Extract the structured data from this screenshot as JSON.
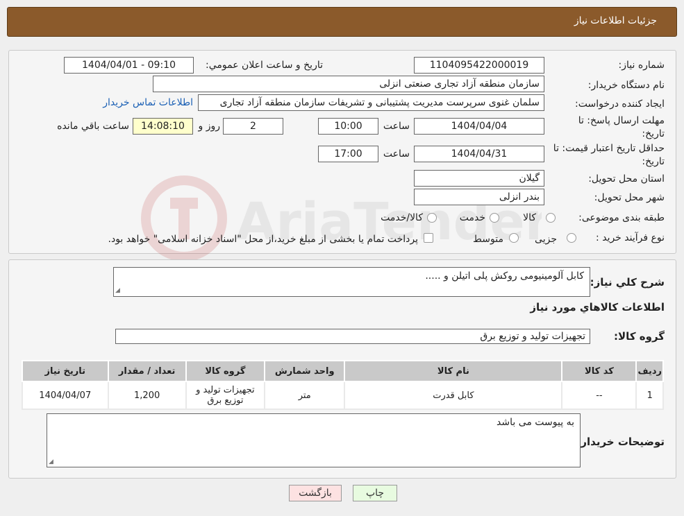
{
  "header": {
    "title": "جزئیات اطلاعات نیاز"
  },
  "form": {
    "need_number_label": "شماره نیاز:",
    "need_number": "1104095422000019",
    "announce_label": "تاریخ و ساعت اعلان عمومي:",
    "announce_value": "1404/04/01 - 09:10",
    "buyer_org_label": "نام دستگاه خریدار:",
    "buyer_org": "سازمان منطقه آزاد تجاری  صنعتی انزلی",
    "creator_label": "ایجاد کننده درخواست:",
    "creator": "سلمان غنوی سرپرست مدیریت پشتیبانی و تشریفات سازمان منطقه آزاد تجاری",
    "contact_link": "اطلاعات تماس خریدار",
    "deadline_label": "مهلت ارسال پاسخ: تا تاریخ:",
    "deadline_date": "1404/04/04",
    "time_label": "ساعت",
    "deadline_time": "10:00",
    "days_value": "2",
    "days_label": "روز و",
    "remaining_time": "14:08:10",
    "remaining_label": "ساعت باقي مانده",
    "validity_label": "حداقل تاریخ اعتبار قیمت: تا تاریخ:",
    "validity_date": "1404/04/31",
    "validity_time": "17:00",
    "province_label": "استان محل تحویل:",
    "province": "گیلان",
    "city_label": "شهر محل تحویل:",
    "city": "بندر انزلی",
    "category_label": "طبقه بندی موضوعی:",
    "category_options": [
      "کالا",
      "خدمت",
      "کالا/خدمت"
    ],
    "purchase_type_label": "نوع فرآیند خرید :",
    "purchase_options": [
      "جزیی",
      "متوسط"
    ],
    "purchase_note": "پرداخت تمام یا بخشی از مبلغ خرید،از محل \"اسناد خزانه اسلامی\" خواهد بود."
  },
  "details": {
    "general_desc_label": "شرح کلي نیاز:",
    "general_desc": "کابل آلومینیومی روکش پلی اتیلن و .....",
    "goods_info_title": "اطلاعات کالاهاي مورد نیاز",
    "goods_group_label": "گروه کالا:",
    "goods_group": "تجهیزات تولید و توزیع برق",
    "table": {
      "headers": [
        "ردیف",
        "کد کالا",
        "نام کالا",
        "واحد شمارش",
        "گروه کالا",
        "تعداد / مقدار",
        "تاریخ نیاز"
      ],
      "rows": [
        [
          "1",
          "--",
          "کابل قدرت",
          "متر",
          "تجهیزات تولید و توزیع برق",
          "1,200",
          "1404/04/07"
        ]
      ]
    },
    "buyer_notes_label": "توضیحات خریدار:",
    "buyer_notes": "به پیوست می باشد"
  },
  "buttons": {
    "print": "چاپ",
    "back": "بازگشت"
  },
  "watermark_text": "AriaTender.net"
}
